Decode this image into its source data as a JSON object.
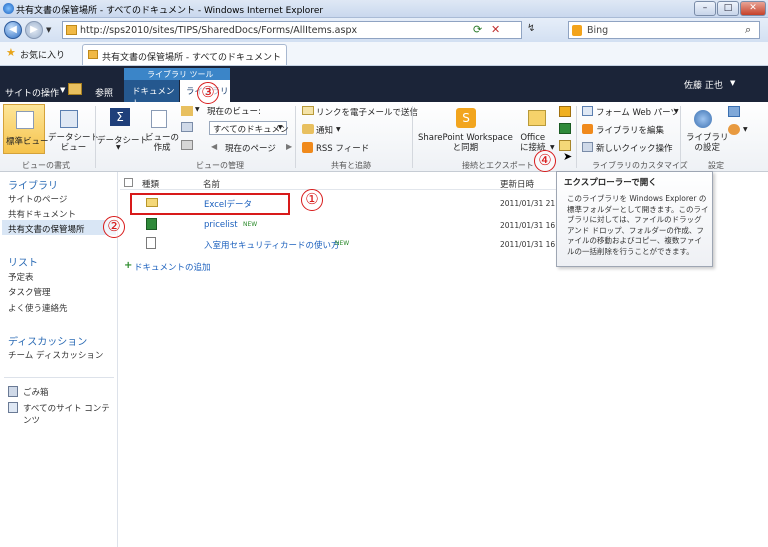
{
  "window": {
    "title": "共有文書の保管場所 - すべてのドキュメント - Windows Internet Explorer",
    "controls": {
      "minimize": "–",
      "maximize": "□",
      "close": "✕"
    }
  },
  "address": {
    "url": "http://sps2010/sites/TIPS/SharedDocs/Forms/AllItems.aspx",
    "search_text": "Bing"
  },
  "favbar": {
    "favorites_label": "お気に入り",
    "tab_title": "共有文書の保管場所 - すべてのドキュメント"
  },
  "sp_top": {
    "site_actions": "サイトの操作",
    "browse": "参照",
    "library_tools": "ライブラリ ツール",
    "tab_documents": "ドキュメント",
    "tab_library": "ライブラリ",
    "user": "佐藤 正也"
  },
  "ribbon": {
    "standard_view": "標準ビュー",
    "datasheet_view": "データシート\nビュー",
    "datasheet": "データシート",
    "create_view": "ビューの\n作成",
    "current_view_label": "現在のビュー:",
    "current_view_value": "すべてのドキュメン",
    "current_page": "現在のページ",
    "email_link": "リンクを電子メールで送信",
    "alerts": "通知",
    "rss": "RSS フィード",
    "sharepoint_workspace": "SharePoint Workspace\nと同期",
    "office_connect": "Office\nに接続",
    "form_web_parts": "フォーム Web パーツ",
    "edit_library": "ライブラリを編集",
    "new_quick_step": "新しいクイック操作",
    "library_settings": "ライブラリ\nの設定",
    "groups": {
      "view_format": "ビューの書式",
      "view_manage": "ビューの管理",
      "share_track": "共有と追跡",
      "connect_export": "接続とエクスポート",
      "customize": "ライブラリのカスタマイズ",
      "settings": "設定"
    }
  },
  "leftnav": {
    "libraries_heading": "ライブラリ",
    "libraries": [
      "サイトのページ",
      "共有ドキュメント",
      "共有文書の保管場所"
    ],
    "lists_heading": "リスト",
    "lists": [
      "予定表",
      "タスク管理",
      "よく使う連絡先"
    ],
    "discussions_heading": "ディスカッション",
    "discussions": [
      "チーム ディスカッション"
    ],
    "recycle_bin": "ごみ箱",
    "all_content": "すべてのサイト コンテンツ"
  },
  "list": {
    "col_type": "種類",
    "col_name": "名前",
    "col_modified": "更新日時",
    "rows": [
      {
        "name": "Excelデータ",
        "date": "2011/01/31 21",
        "new": ""
      },
      {
        "name": "pricelist",
        "date": "2011/01/31 16",
        "new": "NEW"
      },
      {
        "name": "入室用セキュリティカードの使い方",
        "date": "2011/01/31 16",
        "new": "NEW"
      }
    ],
    "add_document": "ドキュメントの追加"
  },
  "tooltip": {
    "title": "エクスプローラーで開く",
    "body": "このライブラリを Windows Explorer の標準フォルダーとして開きます。このライブラリに対しては、ファイルのドラッグ アンド ドロップ、フォルダーの作成、ファイルの移動およびコピー、複数ファイルの一括削除を行うことができます。"
  },
  "callouts": [
    "①",
    "②",
    "③",
    "④"
  ],
  "colors": {
    "accent": "#1a5fbd",
    "callout": "#d81a1a",
    "sp_header": "#1b2438",
    "selected_tab": "#3b85c8"
  }
}
